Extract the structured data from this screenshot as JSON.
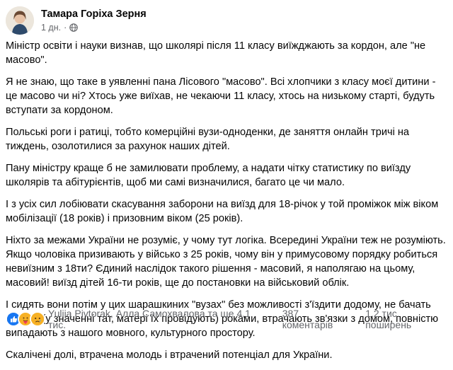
{
  "post": {
    "author": "Тамара Горіха Зерня",
    "time": "1 дн.",
    "separator": "·",
    "audience_icon": "globe-icon",
    "paragraphs": [
      "Міністр освіти і науки визнав, що школярі після 11 класу виїжджають за кордон, але \"не масово\".",
      "Я не знаю, що таке в уявленні пана Лісового \"масово\". Всі хлопчики з класу моєї дитини - це масово чи ні? Хтось уже виїхав, не чекаючи 11 класу, хтось на низькому старті, будуть вступати за кордоном.",
      "Польські роги і ратиці, тобто комерційні вузи-одноденки, де заняття онлайн тричі на тиждень, озолотилися за рахунок наших дітей.",
      "Пану міністру краще б не замилювати проблему, а надати чітку статистику по виїзду школярів та абітурієнтів, щоб ми самі визначилися, багато це чи мало.",
      "І з усіх сил лобіювати скасування заборони на виїзд для 18-річок у той проміжок між віком мобілізації (18 років) і призовним віком (25 років).",
      "Ніхто за межами України не розуміє, у чому тут логіка. Всередині України теж не розуміють. Якщо чоловіка призивають у військо з 25 років, чому він у примусовому порядку робиться невиїзним з 18ти? Єдиний наслідок такого рішення - масовий, я наполягаю на цьому, масовий! виїзд дітей 16-ти років, ще до постановки на військовий облік.",
      "І сидять вони потім у цих шарашкиних \"вузах\" без можливості з'їздити додому, не бачать батьків (у значенні тат, матері їх провідують) роками, втрачають зв'язки з домом, повністю випадають з нашого мовного, культурного простору.",
      "Скалічені долі, втрачена молодь і втрачений потенціал для України."
    ],
    "reactions": [
      "like",
      "care",
      "sad"
    ],
    "reactors": "Yuliia Pivtorak, Алла Самохвалова та ще 4,1 тис.",
    "comments": "387 коментарів",
    "shares": "1,2 тис. поширень",
    "colors": {
      "like": "#1877f2",
      "care": "#f7b125",
      "sad": "#f7b125",
      "secondary": "#65676b"
    }
  }
}
